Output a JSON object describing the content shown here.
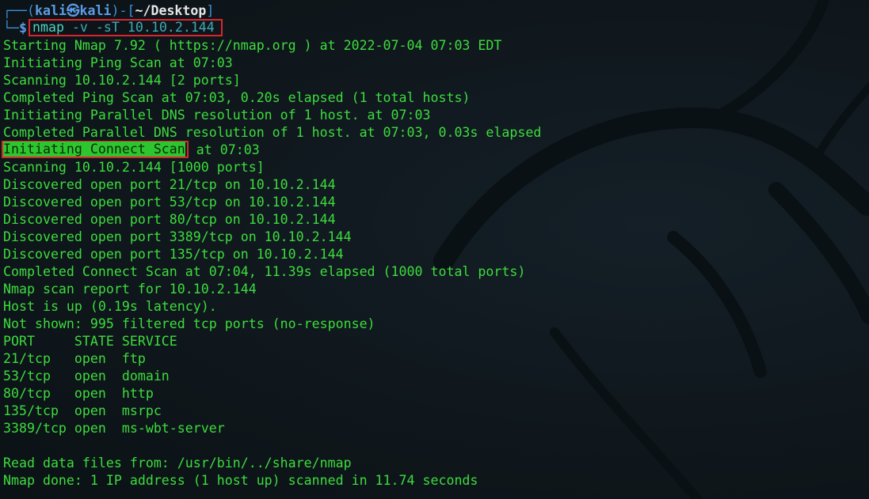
{
  "prompt": {
    "top_prefix": "┌──(",
    "user": "kali",
    "at_symbol": "㉿",
    "host": "kali",
    "mid": ")-[",
    "path": "~/Desktop",
    "end": "]",
    "bottom_prefix": "└─",
    "dollar": "$"
  },
  "command": {
    "name": "nmap",
    "args": " -v -sT ",
    "target": "10.10.2.144"
  },
  "output": {
    "lines_before_highlight": [
      "Starting Nmap 7.92 ( https://nmap.org ) at 2022-07-04 07:03 EDT",
      "Initiating Ping Scan at 07:03",
      "Scanning 10.10.2.144 [2 ports]",
      "Completed Ping Scan at 07:03, 0.20s elapsed (1 total hosts)",
      "Initiating Parallel DNS resolution of 1 host. at 07:03",
      "Completed Parallel DNS resolution of 1 host. at 07:03, 0.03s elapsed"
    ],
    "highlight_text": "Initiating Connect Scan",
    "highlight_rest": " at 07:03",
    "lines_after_highlight": [
      "Scanning 10.10.2.144 [1000 ports]",
      "Discovered open port 21/tcp on 10.10.2.144",
      "Discovered open port 53/tcp on 10.10.2.144",
      "Discovered open port 80/tcp on 10.10.2.144",
      "Discovered open port 3389/tcp on 10.10.2.144",
      "Discovered open port 135/tcp on 10.10.2.144",
      "Completed Connect Scan at 07:04, 11.39s elapsed (1000 total ports)",
      "Nmap scan report for 10.10.2.144",
      "Host is up (0.19s latency).",
      "Not shown: 995 filtered tcp ports (no-response)",
      "PORT     STATE SERVICE",
      "21/tcp   open  ftp",
      "53/tcp   open  domain",
      "80/tcp   open  http",
      "135/tcp  open  msrpc",
      "3389/tcp open  ms-wbt-server"
    ],
    "footer_lines": [
      "Read data files from: /usr/bin/../share/nmap",
      "Nmap done: 1 IP address (1 host up) scanned in 11.74 seconds"
    ]
  },
  "colors": {
    "background": "#0f171c",
    "output_text": "#3ddc3d",
    "highlight_fill": "#2ec62e",
    "annotation_border": "#d9262e",
    "prompt_blue": "#5c9ce6"
  },
  "icons": {
    "background_art": "kali-dragon-icon"
  }
}
